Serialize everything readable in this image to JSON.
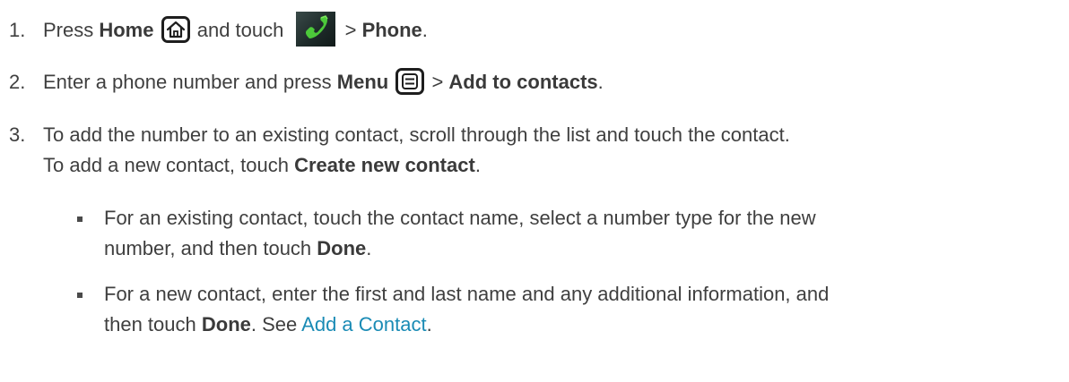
{
  "steps": [
    {
      "num": "1.",
      "t1": "Press ",
      "b1": "Home",
      "t2": " and touch ",
      "t3": " > ",
      "b2": "Phone",
      "t4": "."
    },
    {
      "num": "2.",
      "t1": "Enter a phone number and press ",
      "b1": "Menu",
      "t2": " > ",
      "b2": "Add to contacts",
      "t3": "."
    },
    {
      "num": "3.",
      "line1": "To add the number to an existing contact, scroll through the list and touch the contact.",
      "line2_t1": "To add a new contact, touch ",
      "line2_b1": "Create new contact",
      "line2_t2": "."
    }
  ],
  "bullets": [
    {
      "line1": "For an existing contact, touch the contact name, select a number type for the new",
      "line2_t1": "number, and then touch ",
      "line2_b1": "Done",
      "line2_t2": "."
    },
    {
      "line1": "For a new contact, enter the first and last name and any additional information, and",
      "line2_t1": "then touch ",
      "line2_b1": "Done",
      "line2_t2": ". See ",
      "link": "Add a Contact",
      "line2_t3": "."
    }
  ],
  "icons": {
    "home": "home-icon",
    "phone": "phone-app-icon",
    "menu": "menu-icon"
  }
}
